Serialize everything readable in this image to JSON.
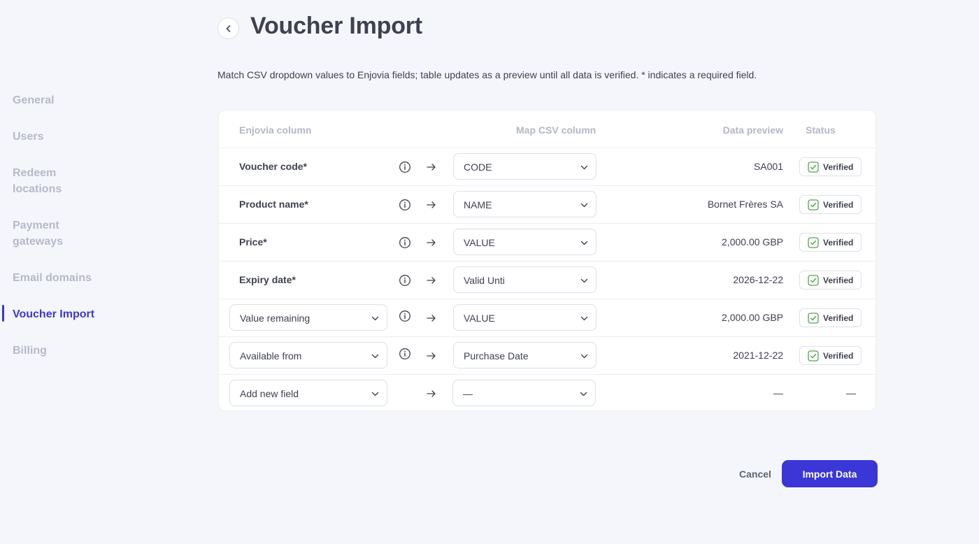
{
  "sidebar": {
    "items": [
      {
        "label": "General"
      },
      {
        "label": "Users"
      },
      {
        "label": "Redeem\nlocations"
      },
      {
        "label": "Payment\ngateways"
      },
      {
        "label": "Email domains"
      },
      {
        "label": "Voucher Import",
        "active": true
      },
      {
        "label": "Billing"
      }
    ]
  },
  "header": {
    "title": "Voucher Import",
    "description": "Match CSV dropdown values to Enjovia fields; table updates as a preview until all data is verified. * indicates a required field."
  },
  "table": {
    "columns": {
      "enjovia": "Enjovia column",
      "map_csv": "Map CSV column",
      "preview": "Data preview",
      "status": "Status"
    },
    "rows": [
      {
        "field": "Voucher code*",
        "csv": "CODE",
        "preview": "SA001",
        "status": "Verified"
      },
      {
        "field": "Product name*",
        "csv": "NAME",
        "preview": "Bornet Frères SA",
        "status": "Verified"
      },
      {
        "field": "Price*",
        "csv": "VALUE",
        "preview": "2,000.00 GBP",
        "status": "Verified"
      },
      {
        "field": "Expiry date*",
        "csv": "Valid Unti",
        "preview": "2026-12-22",
        "status": "Verified"
      },
      {
        "field": "Value remaining",
        "csv": "VALUE",
        "preview": "2,000.00 GBP",
        "status": "Verified"
      },
      {
        "field": "Available from",
        "csv": "Purchase Date",
        "preview": "2021-12-22",
        "status": "Verified"
      },
      {
        "field": "Add new field",
        "csv": "—",
        "preview": "—",
        "status": "—"
      }
    ]
  },
  "actions": {
    "cancel": "Cancel",
    "import": "Import Data"
  },
  "colors": {
    "accent": "#3b37d6",
    "verified_check": "#4fa54f",
    "background": "#f5f6fb"
  },
  "icons": {
    "back": "chevron-left-icon",
    "info": "info-icon",
    "arrow": "arrow-right-icon",
    "dropdown": "chevron-down-icon",
    "verified": "check-square-icon"
  }
}
